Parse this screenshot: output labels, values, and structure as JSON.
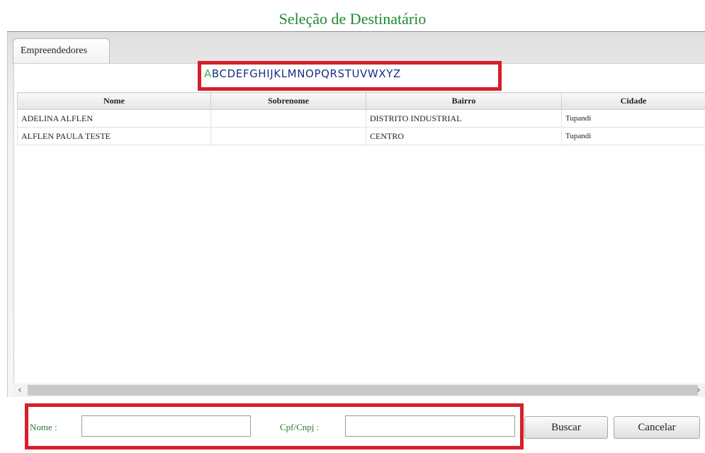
{
  "window": {
    "title": "Seleção de Destinatário"
  },
  "tabs": [
    {
      "label": "Empreendedores"
    }
  ],
  "alphabet": {
    "active": "A",
    "letters": [
      "A",
      "B",
      "C",
      "D",
      "E",
      "F",
      "G",
      "H",
      "I",
      "J",
      "K",
      "L",
      "M",
      "N",
      "O",
      "P",
      "Q",
      "R",
      "S",
      "T",
      "U",
      "V",
      "W",
      "X",
      "Y",
      "Z"
    ]
  },
  "grid": {
    "columns": [
      "Nome",
      "Sobrenome",
      "Bairro",
      "Cidade"
    ],
    "rows": [
      {
        "nome": "ADELINA ALFLEN",
        "sobrenome": "",
        "bairro": "DISTRITO INDUSTRIAL",
        "cidade": "Tupandi"
      },
      {
        "nome": "ALFLEN PAULA TESTE",
        "sobrenome": "",
        "bairro": "CENTRO",
        "cidade": "Tupandi"
      }
    ]
  },
  "scrollbar": {
    "left_icon": "chevron-left-icon",
    "right_icon": "chevron-right-icon"
  },
  "search": {
    "nome_label": "Nome :",
    "nome_value": "",
    "cpf_label": "Cpf/Cnpj :",
    "cpf_value": "",
    "buscar_label": "Buscar",
    "cancelar_label": "Cancelar"
  },
  "colors": {
    "title": "#1e8a2e",
    "link": "#1b2e84",
    "active_letter": "#37b34a",
    "highlight": "#d71f2b"
  }
}
